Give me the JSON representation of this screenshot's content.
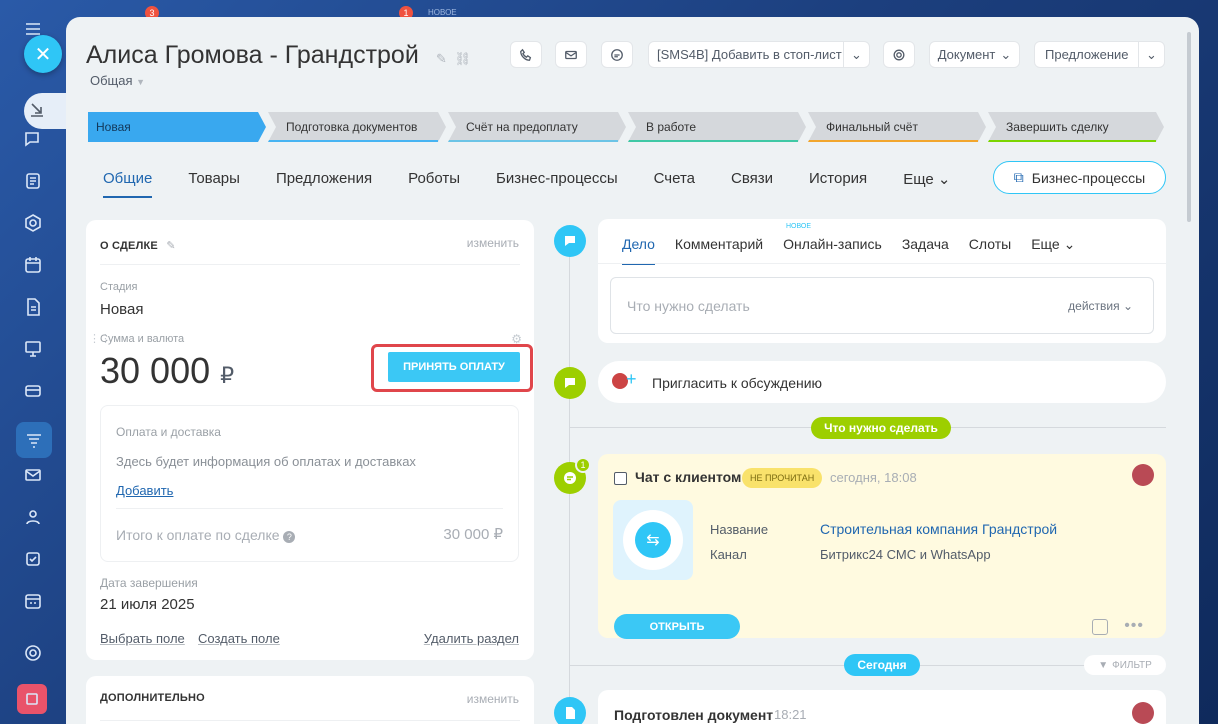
{
  "deal": {
    "title": "Алиса Громова - Грандстрой",
    "category": "Общая"
  },
  "topbar": {
    "badge_a": "3",
    "badge_b": "1",
    "new_label": "НОВОЕ"
  },
  "toolbar": {
    "sms_label": "[SMS4B] Добавить в стоп-лист",
    "document_label": "Документ",
    "proposal_label": "Предложение"
  },
  "stages": [
    {
      "label": "Новая",
      "color": "#39a8ef"
    },
    {
      "label": "Подготовка документов",
      "color": "#47b4f2"
    },
    {
      "label": "Счёт на предоплату",
      "color": "#6cc4e6"
    },
    {
      "label": "В работе",
      "color": "#3fc8a5"
    },
    {
      "label": "Финальный счёт",
      "color": "#f2a62d"
    },
    {
      "label": "Завершить сделку",
      "color": "#7bd500"
    }
  ],
  "tabs": [
    "Общие",
    "Товары",
    "Предложения",
    "Роботы",
    "Бизнес-процессы",
    "Счета",
    "Связи",
    "История",
    "Еще"
  ],
  "bp_button": "Бизнес-процессы",
  "about": {
    "header": "О СДЕЛКЕ",
    "edit": "изменить",
    "stage_label": "Стадия",
    "stage_value": "Новая",
    "sum_label": "Сумма и валюта",
    "sum_value": "30 000",
    "currency": "₽",
    "pay_button": "ПРИНЯТЬ ОПЛАТУ",
    "payment": {
      "title": "Оплата и доставка",
      "info": "Здесь будет информация об оплатах и доставках",
      "add": "Добавить",
      "total_label": "Итого к оплате по сделке",
      "total_value": "30 000 ₽"
    },
    "close_label": "Дата завершения",
    "close_value": "21 июля 2025",
    "select_field": "Выбрать поле",
    "create_field": "Создать поле",
    "delete_section": "Удалить раздел"
  },
  "additional": {
    "header": "ДОПОЛНИТЕЛЬНО",
    "edit": "изменить"
  },
  "activity": {
    "tabs": [
      "Дело",
      "Комментарий",
      "Онлайн-запись",
      "Задача",
      "Слоты",
      "Еще"
    ],
    "new_badge": "НОВОЕ",
    "placeholder": "Что нужно сделать",
    "actions": "действия",
    "invite": "Пригласить к обсуждению",
    "todo_pill": "Что нужно сделать"
  },
  "chat": {
    "title": "Чат с клиентом",
    "unread": "НЕ ПРОЧИТАН",
    "time": "сегодня, 18:08",
    "badge": "1",
    "name_label": "Название",
    "name_value": "Строительная компания Грандстрой",
    "channel_label": "Канал",
    "channel_value": "Битрикс24 СМС и WhatsApp",
    "open_button": "ОТКРЫТЬ"
  },
  "today_pill": "Сегодня",
  "filter": "ФИЛЬТР",
  "doc": {
    "title": "Подготовлен документ",
    "time": "18:21"
  }
}
